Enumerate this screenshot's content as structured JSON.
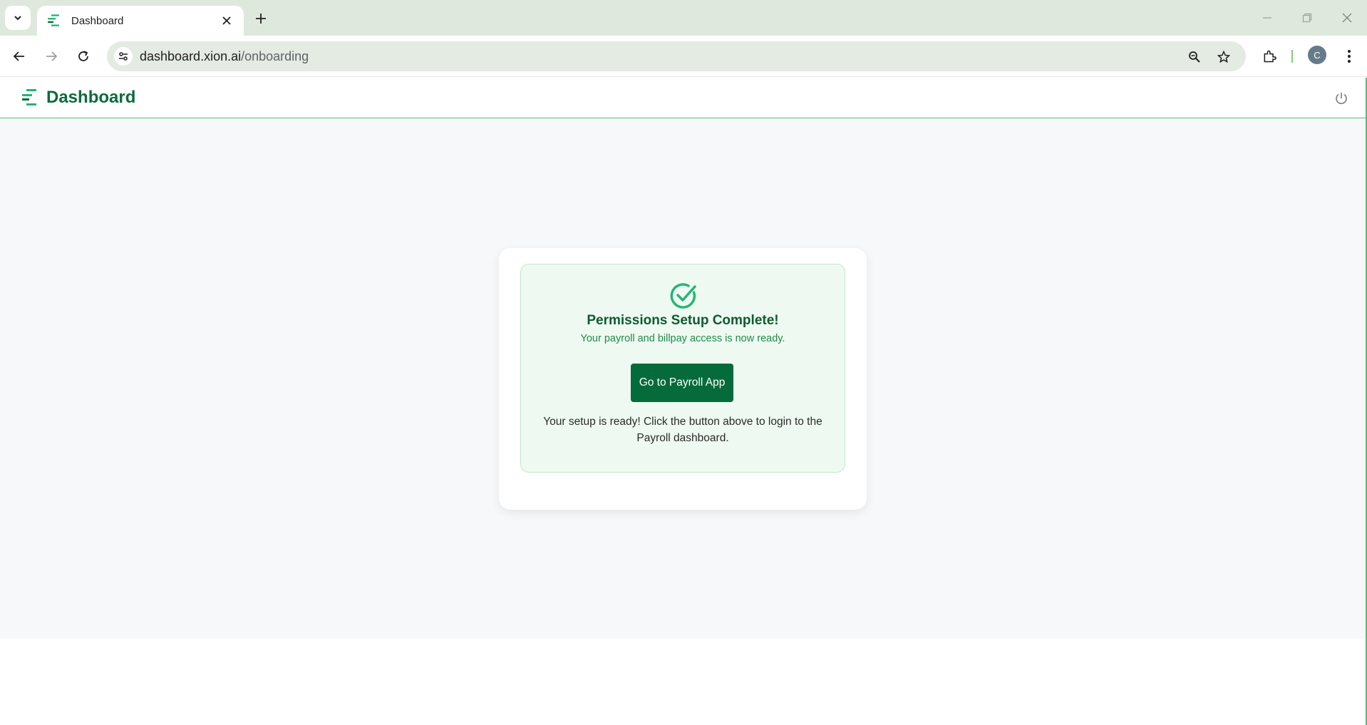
{
  "browser": {
    "tab": {
      "title": "Dashboard"
    },
    "address": {
      "host": "dashboard.xion.ai",
      "path": "/onboarding"
    },
    "profile_initial": "C"
  },
  "header": {
    "brand": "Dashboard"
  },
  "success": {
    "title": "Permissions Setup Complete!",
    "subtitle": "Your payroll and billpay access is now ready.",
    "button_label": "Go to Payroll App",
    "note": "Your setup is ready! Click the button above to login to the Payroll dashboard."
  },
  "colors": {
    "brand_green": "#0a6b3c",
    "button_green": "#056b3a",
    "success_bg": "#eefaf1",
    "success_border": "#bfe8cc",
    "accent_green": "#22b573"
  },
  "icons": [
    "tab-list-icon",
    "logo-icon",
    "close-icon",
    "plus-icon",
    "minimize-icon",
    "restore-icon",
    "back-icon",
    "forward-icon",
    "reload-icon",
    "site-info-icon",
    "zoom-icon",
    "star-icon",
    "extensions-icon",
    "menu-icon",
    "power-icon",
    "check-circle-icon"
  ]
}
